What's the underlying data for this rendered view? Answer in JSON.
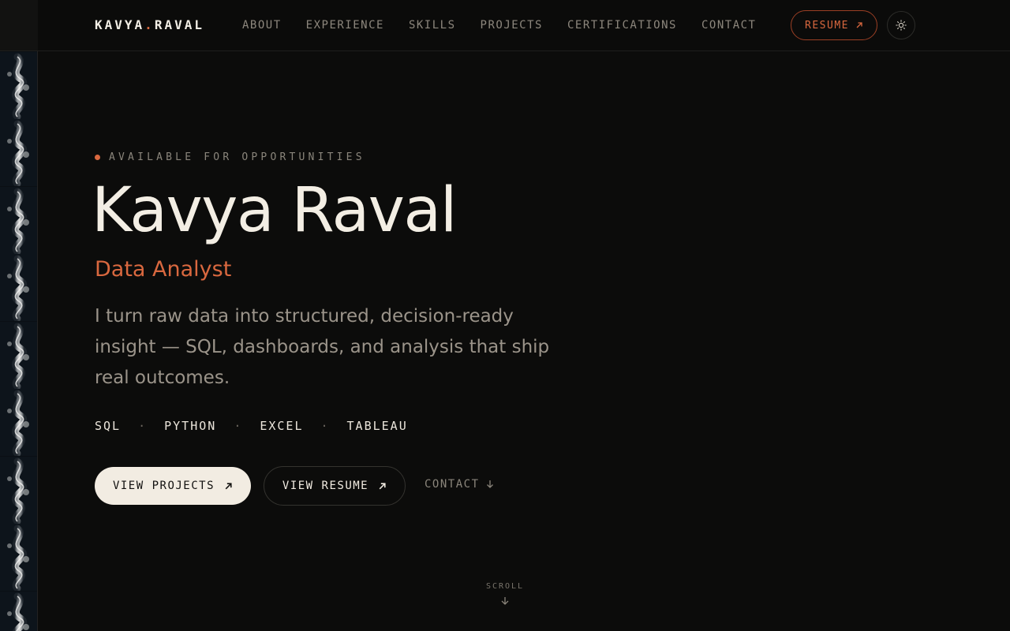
{
  "nav": {
    "brand_first": "KAVYA",
    "brand_dot": ".",
    "brand_last": "RAVAL",
    "links": [
      "ABOUT",
      "EXPERIENCE",
      "SKILLS",
      "PROJECTS",
      "CERTIFICATIONS",
      "CONTACT"
    ],
    "resume_label": "RESUME",
    "theme_icon": "sun-icon"
  },
  "hero": {
    "availability": "AVAILABLE FOR OPPORTUNITIES",
    "name": "Kavya Raval",
    "role": "Data Analyst",
    "description": "I turn raw data into structured, decision-ready insight — SQL, dashboards, and analysis that ship real outcomes.",
    "skills": [
      "SQL",
      "PYTHON",
      "EXCEL",
      "TABLEAU"
    ],
    "skill_separator": "·",
    "primary_cta": "VIEW PROJECTS",
    "secondary_cta": "VIEW RESUME",
    "contact_link": "CONTACT",
    "scroll_label": "SCROLL"
  },
  "colors": {
    "background": "#0c0c0b",
    "accent": "#d9683f",
    "text": "#f2ece2",
    "muted": "#8d877d"
  }
}
